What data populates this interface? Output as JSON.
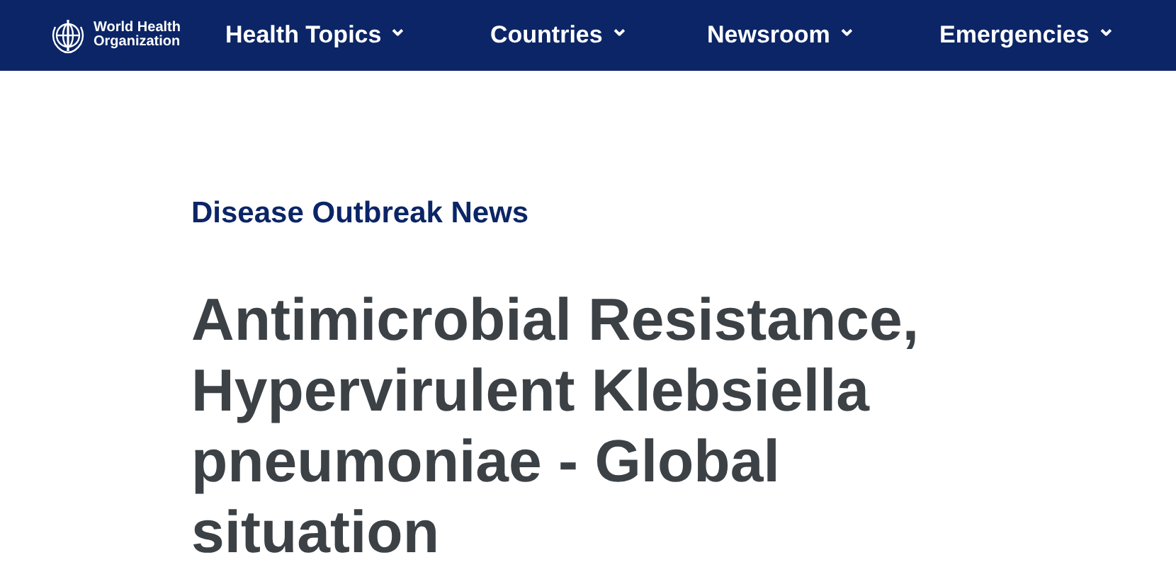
{
  "header": {
    "logo_text": "World Health Organization",
    "nav": [
      {
        "label": "Health Topics",
        "caret": "⌄"
      },
      {
        "label": "Countries",
        "caret": "⌄"
      },
      {
        "label": "Newsroom",
        "caret": "⌄"
      },
      {
        "label": "Emergencies",
        "caret": "⌄"
      }
    ]
  },
  "article": {
    "category": "Disease Outbreak News",
    "title": "Antimicrobial Resistance, Hypervirulent Klebsiella pneumoniae - Global situation"
  }
}
